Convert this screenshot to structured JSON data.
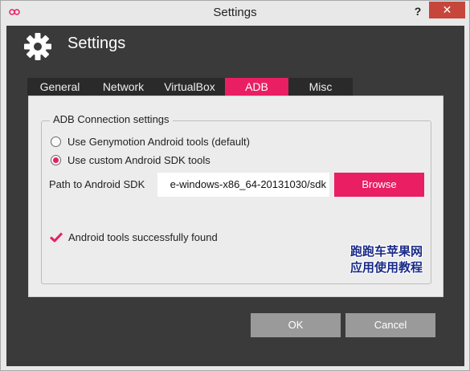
{
  "window": {
    "title": "Settings",
    "help_label": "?",
    "close_label": "✕"
  },
  "header": {
    "title": "Settings",
    "icon": "gear-icon"
  },
  "tabs": [
    {
      "label": "General",
      "active": false
    },
    {
      "label": "Network",
      "active": false
    },
    {
      "label": "VirtualBox",
      "active": false
    },
    {
      "label": "ADB",
      "active": true
    },
    {
      "label": "Misc",
      "active": false
    }
  ],
  "adb": {
    "group_title": "ADB Connection settings",
    "options": [
      {
        "label": "Use Genymotion Android tools (default)",
        "checked": false
      },
      {
        "label": "Use custom Android SDK tools",
        "checked": true
      }
    ],
    "path_label": "Path to Android SDK",
    "path_value": "e-windows-x86_64-20131030/sdk",
    "browse_label": "Browse",
    "status_text": "Android tools successfully found"
  },
  "watermark": {
    "line1": "跑跑车苹果网",
    "line2": "应用使用教程"
  },
  "footer": {
    "ok_label": "OK",
    "cancel_label": "Cancel"
  },
  "colors": {
    "accent": "#e91e63",
    "dark_bg": "#3a3a3a",
    "close": "#c7463b"
  }
}
